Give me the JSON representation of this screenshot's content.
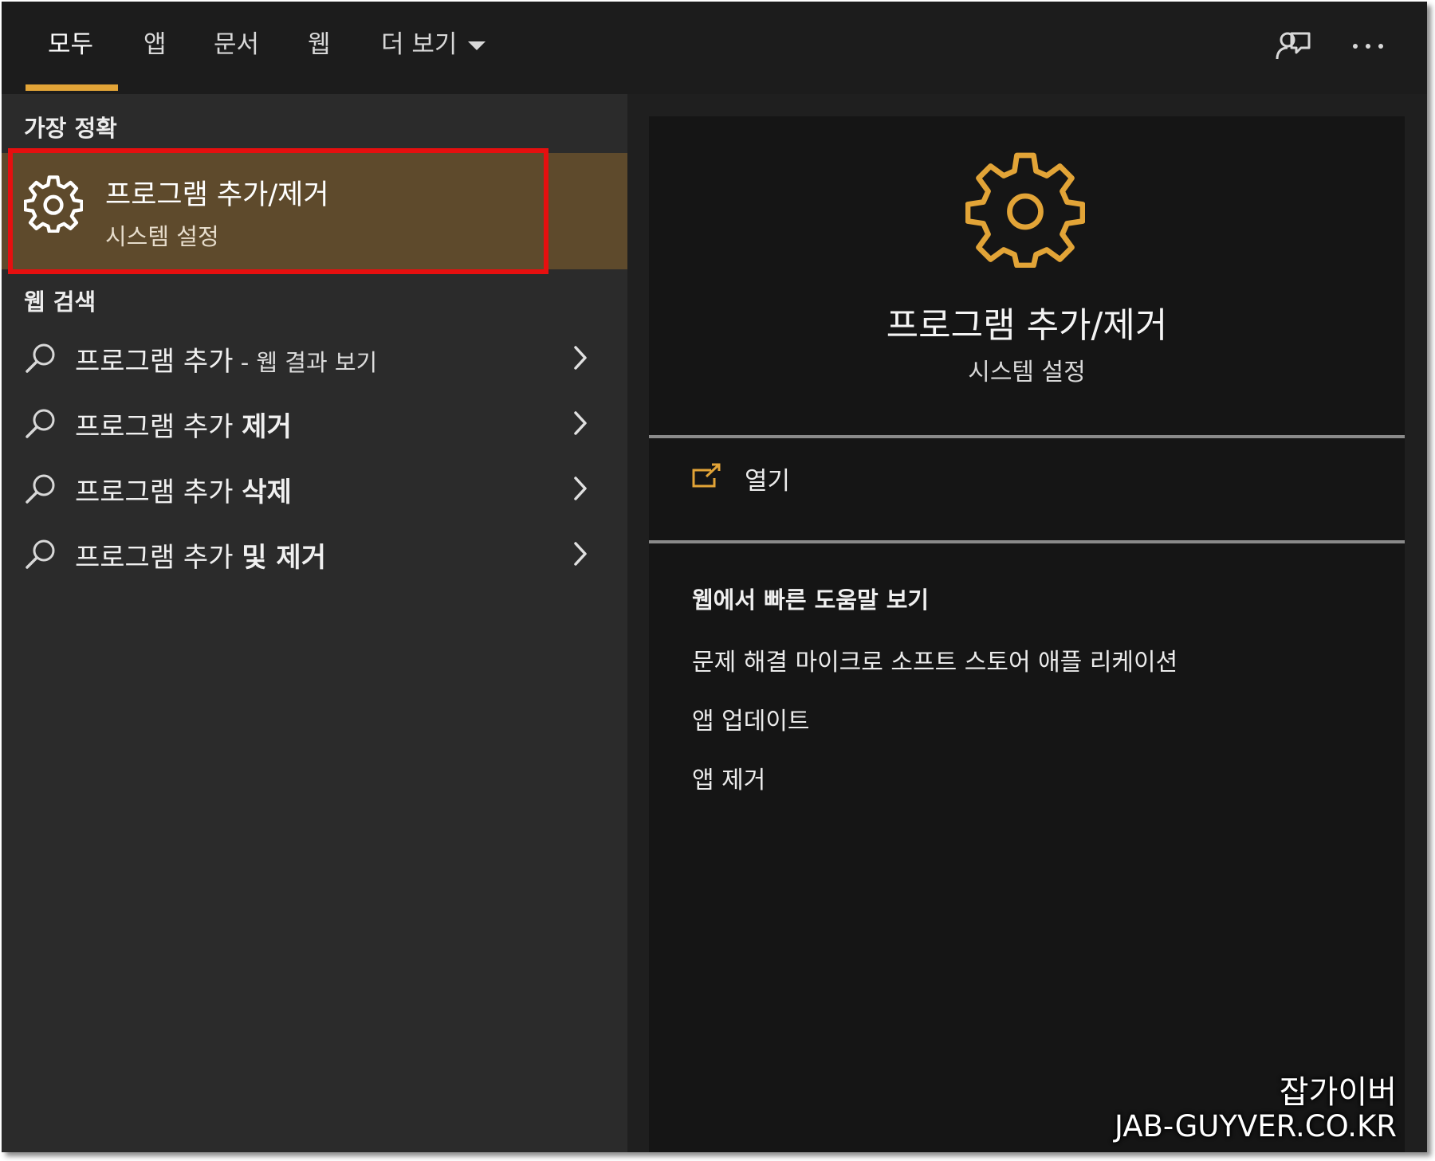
{
  "tabs": [
    {
      "label": "모두"
    },
    {
      "label": "앱"
    },
    {
      "label": "문서"
    },
    {
      "label": "웹"
    },
    {
      "label": "더 보기"
    }
  ],
  "colors": {
    "accent": "#e2a437",
    "selected_bg": "#5e4a2c",
    "highlight_border": "#e60f0f"
  },
  "left": {
    "best_match_heading": "가장 정확",
    "best_match": {
      "title": "프로그램 추가/제거",
      "subtitle": "시스템 설정",
      "icon": "gear-icon"
    },
    "web_search_heading": "웹 검색",
    "web_results": [
      {
        "prefix": "프로그램 추가",
        "bold": "",
        "suffix": " - 웹 결과 보기"
      },
      {
        "prefix": "프로그램 추가 ",
        "bold": "제거",
        "suffix": ""
      },
      {
        "prefix": "프로그램 추가 ",
        "bold": "삭제",
        "suffix": ""
      },
      {
        "prefix": "프로그램 추가 ",
        "bold": "및 제거",
        "suffix": ""
      }
    ]
  },
  "right": {
    "title": "프로그램 추가/제거",
    "subtitle": "시스템 설정",
    "open_label": "열기",
    "help_heading": "웹에서 빠른 도움말 보기",
    "help_links": [
      "문제 해결 마이크로 소프트 스토어 애플 리케이션",
      "앱 업데이트",
      "앱 제거"
    ]
  },
  "watermark": {
    "line1": "잡가이버",
    "line2": "JAB-GUYVER.CO.KR"
  }
}
